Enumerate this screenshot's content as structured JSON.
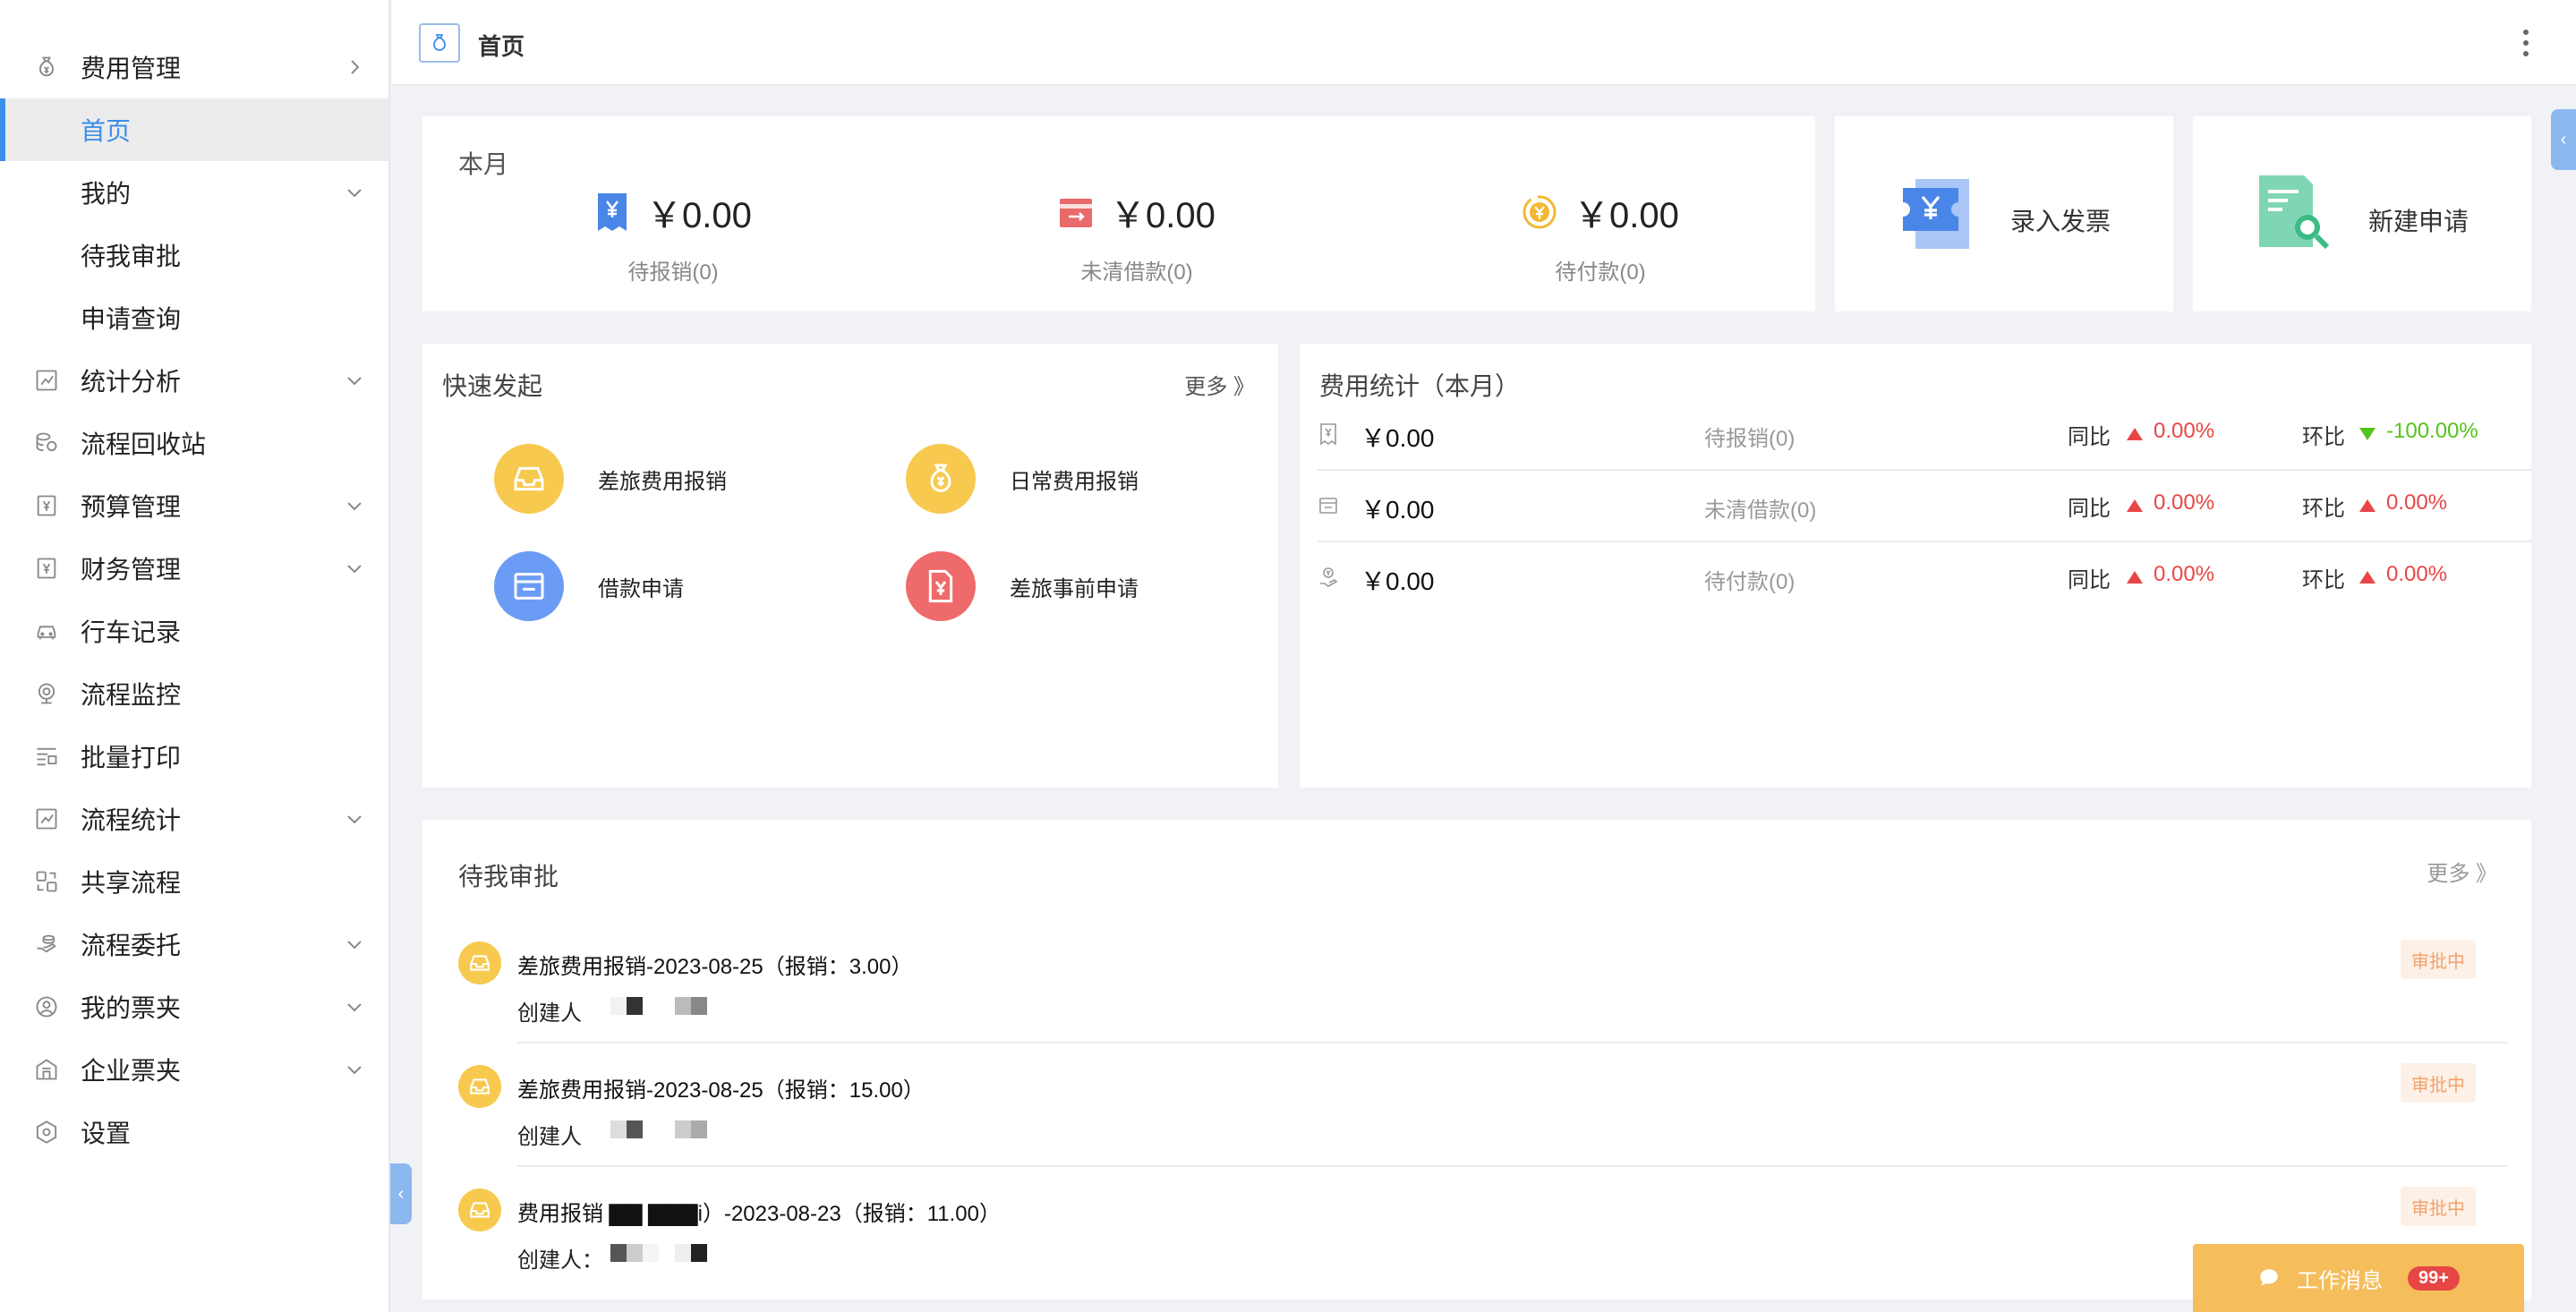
{
  "sidebar": {
    "items": [
      {
        "label": "费用管理",
        "icon": "money-bag-icon",
        "arrow": "right"
      },
      {
        "label": "首页",
        "active": true
      },
      {
        "label": "我的",
        "arrow": "down"
      },
      {
        "label": "待我审批"
      },
      {
        "label": "申请查询"
      },
      {
        "label": "统计分析",
        "icon": "chart-icon",
        "arrow": "down"
      },
      {
        "label": "流程回收站",
        "icon": "coins-icon"
      },
      {
        "label": "预算管理",
        "icon": "yen-doc-icon",
        "arrow": "down"
      },
      {
        "label": "财务管理",
        "icon": "yen-doc-icon",
        "arrow": "down"
      },
      {
        "label": "行车记录",
        "icon": "car-icon"
      },
      {
        "label": "流程监控",
        "icon": "camera-icon"
      },
      {
        "label": "批量打印",
        "icon": "print-list-icon"
      },
      {
        "label": "流程统计",
        "icon": "chart-icon",
        "arrow": "down"
      },
      {
        "label": "共享流程",
        "icon": "share-icon"
      },
      {
        "label": "流程委托",
        "icon": "hand-coins-icon",
        "arrow": "down"
      },
      {
        "label": "我的票夹",
        "icon": "user-circle-icon",
        "arrow": "down"
      },
      {
        "label": "企业票夹",
        "icon": "building-icon",
        "arrow": "down"
      },
      {
        "label": "设置",
        "icon": "settings-icon"
      }
    ]
  },
  "topbar": {
    "tab_label": "首页"
  },
  "month_card": {
    "title": "本月",
    "stats": [
      {
        "amount": "￥0.00",
        "label": "待报销(0)",
        "icon": "receipt-yen-icon",
        "color": "#4a86e8"
      },
      {
        "amount": "￥0.00",
        "label": "未清借款(0)",
        "icon": "card-icon",
        "color": "#e86a6a"
      },
      {
        "amount": "￥0.00",
        "label": "待付款(0)",
        "icon": "yen-coin-icon",
        "color": "#f4b731"
      }
    ]
  },
  "actions": {
    "invoice_label": "录入发票",
    "new_request_label": "新建申请"
  },
  "quick_start": {
    "title": "快速发起",
    "more": "更多 》",
    "items": [
      {
        "label": "差旅费用报销",
        "icon": "inbox-icon",
        "color": "#f7c94e"
      },
      {
        "label": "日常费用报销",
        "icon": "money-bag-icon",
        "color": "#f7c94e"
      },
      {
        "label": "借款申请",
        "icon": "card-icon",
        "color": "#6b9cf5"
      },
      {
        "label": "差旅事前申请",
        "icon": "doc-yen-icon",
        "color": "#ef6a6a"
      }
    ]
  },
  "expense_stats": {
    "title": "费用统计（本月）",
    "yoy_label": "同比",
    "mom_label": "环比",
    "rows": [
      {
        "amount": "￥0.00",
        "label": "待报销(0)",
        "yoy": "0.00%",
        "mom": "-100.00%",
        "mom_trend": "down"
      },
      {
        "amount": "￥0.00",
        "label": "未清借款(0)",
        "yoy": "0.00%",
        "mom": "0.00%",
        "mom_trend": "up"
      },
      {
        "amount": "￥0.00",
        "label": "待付款(0)",
        "yoy": "0.00%",
        "mom": "0.00%",
        "mom_trend": "up"
      }
    ]
  },
  "pending": {
    "title": "待我审批",
    "more": "更多 》",
    "items": [
      {
        "title": "差旅费用报销-2023-08-25（报销：3.00）",
        "creator_label": "创建人",
        "status": "审批中"
      },
      {
        "title": "差旅费用报销-2023-08-25（报销：15.00）",
        "creator_label": "创建人",
        "status": "审批中"
      },
      {
        "title": "费用报销 ▇▇ ▇▇▇i）-2023-08-23（报销：11.00）",
        "creator_label": "创建人：",
        "status": "审批中"
      }
    ]
  },
  "work_message": {
    "label": "工作消息",
    "badge": "99+"
  }
}
